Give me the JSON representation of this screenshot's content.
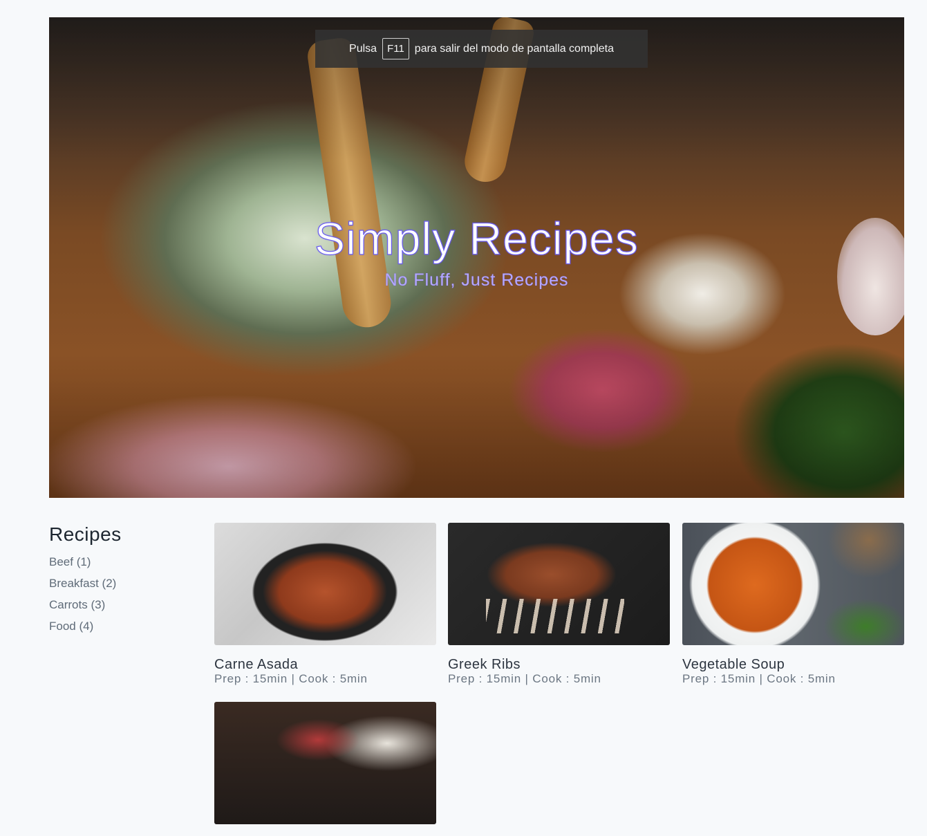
{
  "hero": {
    "title": "Simply Recipes",
    "subtitle": "No Fluff, Just Recipes"
  },
  "fullscreen_notice": {
    "prefix": "Pulsa",
    "key": "F11",
    "suffix": "para salir del modo de pantalla completa"
  },
  "sidebar": {
    "heading": "Recipes",
    "categories": [
      {
        "label": "Beef (1)"
      },
      {
        "label": "Breakfast (2)"
      },
      {
        "label": "Carrots (3)"
      },
      {
        "label": "Food (4)"
      }
    ]
  },
  "recipes": [
    {
      "name": "Carne Asada",
      "meta": "Prep : 15min | Cook : 5min"
    },
    {
      "name": "Greek Ribs",
      "meta": "Prep : 15min | Cook : 5min"
    },
    {
      "name": "Vegetable Soup",
      "meta": "Prep : 15min | Cook : 5min"
    },
    {
      "name": "",
      "meta": ""
    }
  ],
  "colors": {
    "background": "#f7f9fb",
    "title_stroke": "#6a5cf0",
    "subtitle": "#b5a8ff",
    "category_text": "#5f6b78"
  }
}
